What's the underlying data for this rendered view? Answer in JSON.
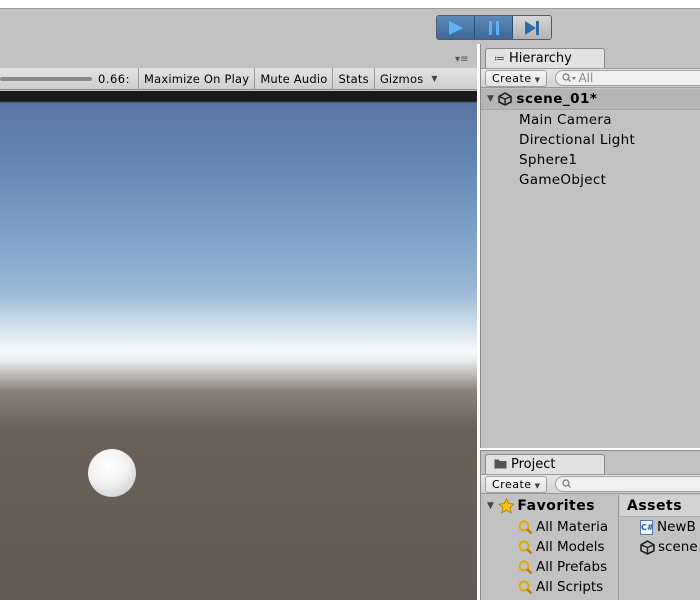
{
  "toolbar": {
    "play_buttons": [
      {
        "icon": "play-icon"
      },
      {
        "icon": "pause-icon"
      },
      {
        "icon": "step-icon"
      }
    ]
  },
  "game_view": {
    "scale_value": "0.66:",
    "buttons": [
      "Maximize On Play",
      "Mute Audio",
      "Stats",
      "Gizmos"
    ]
  },
  "hierarchy": {
    "tab_label": "Hierarchy",
    "tab_icon": "≔",
    "create_label": "Create",
    "search_placeholder": "All",
    "scene_name": "scene_01*",
    "items": [
      "Main Camera",
      "Directional Light",
      "Sphere1",
      "GameObject"
    ]
  },
  "project": {
    "tab_label": "Project",
    "create_label": "Create",
    "favorites_label": "Favorites",
    "favorites": [
      "All Materia",
      "All Models",
      "All Prefabs",
      "All Scripts"
    ],
    "assets_label": "Assets",
    "assets": [
      "NewB",
      "scene"
    ]
  },
  "colors": {
    "play_active": "#4a7aad",
    "panel_bg": "#c2c2c2",
    "ground": "#625a53",
    "sky": "#6a8cb8"
  }
}
